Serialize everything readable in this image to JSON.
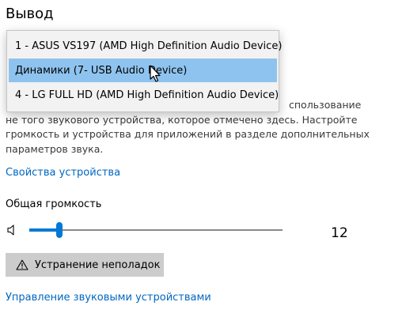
{
  "section": {
    "title": "Вывод"
  },
  "dropdown": {
    "options": [
      "1 - ASUS VS197 (AMD High Definition Audio Device)",
      "Динамики (7- USB Audio Device)",
      "4 - LG FULL HD (AMD High Definition Audio Device)"
    ],
    "selected_index": 1
  },
  "description": {
    "lines": [
      "спользование",
      "не того звукового устройства, которое отмечено здесь. Настройте",
      "громкость и устройства для приложений в разделе дополнительных",
      "параметров звука."
    ]
  },
  "device_properties_link": "Свойства устройства",
  "volume": {
    "label": "Общая громкость",
    "value": "12",
    "level": 12,
    "icon": "speaker-icon"
  },
  "troubleshoot_button": {
    "label": "Устранение неполадок",
    "icon": "warning-icon"
  },
  "manage_devices_link": "Управление звуковыми устройствами",
  "colors": {
    "accent": "#0078d4",
    "link": "#0067c0",
    "selected_option": "#8fc3ef",
    "button_bg": "#cccccc"
  }
}
